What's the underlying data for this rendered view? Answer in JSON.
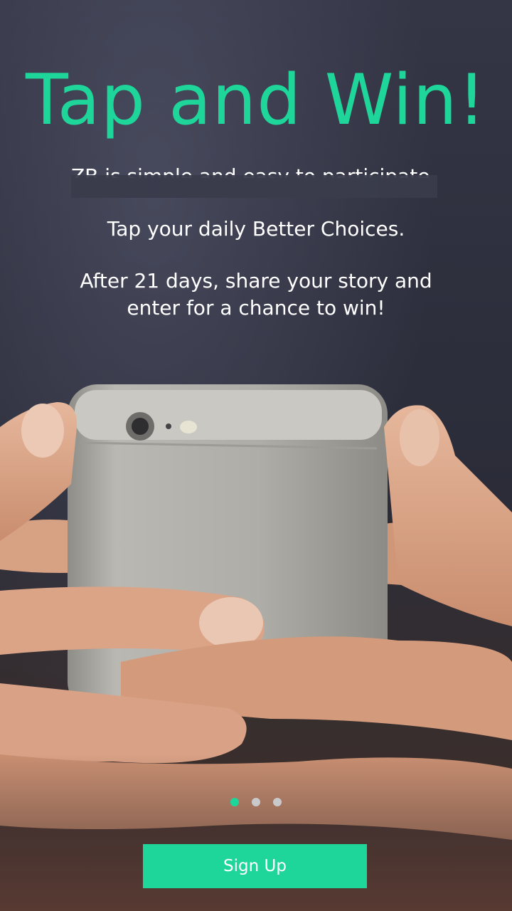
{
  "onboarding": {
    "title": "Tap and Win!",
    "clipped_text": "ZB is simple and easy to participate",
    "line1": "Tap your daily Better Choices.",
    "line2a": "After 21 days, share your story and",
    "line2b": "enter for a chance to win!",
    "page_indicator": {
      "total": 3,
      "current": 1
    },
    "signup_label": "Sign Up"
  },
  "colors": {
    "accent": "#1fd69a",
    "background": "#2f3140",
    "text": "#ffffff"
  }
}
